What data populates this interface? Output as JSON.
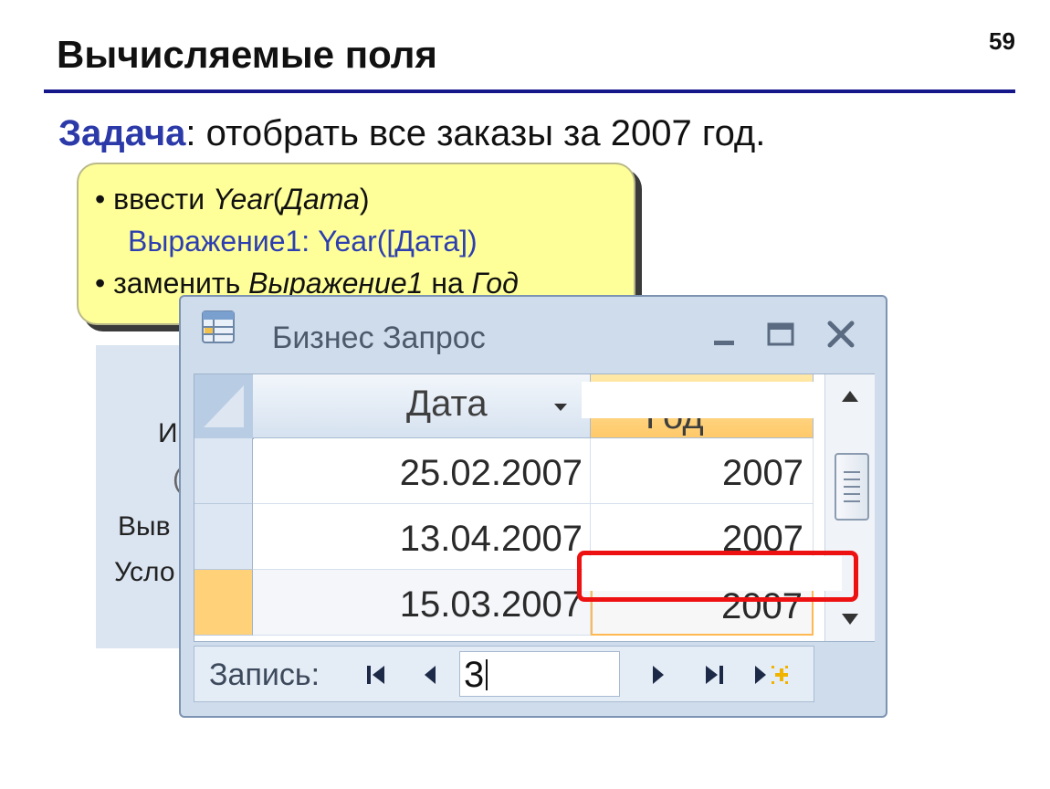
{
  "slide": {
    "title": "Вычисляемые поля",
    "page_number": "59",
    "task_label": "Задача",
    "task_text": ": отобрать все заказы за 2007 год."
  },
  "hint": {
    "line1_prefix": "• ввести ",
    "line1_fn": "Year",
    "line1_open": "(",
    "line1_arg": "Дата",
    "line1_close": ")",
    "line2_expr": "Выражение1: Year([Дата])",
    "line3_prefix": "• заменить ",
    "line3_old": "Выражение1",
    "line3_mid": " на ",
    "line3_new": "Год"
  },
  "design_fragment": {
    "texts": [
      "И",
      "(",
      "Выв",
      "Усло"
    ]
  },
  "window": {
    "title": "Бизнес Запрос",
    "icons": {
      "app": "datasheet-icon",
      "minimize": "minimize-icon",
      "maximize": "maximize-icon",
      "close": "close-icon"
    },
    "columns": [
      "Дата",
      "Год"
    ],
    "rows": [
      {
        "date": "25.02.2007",
        "year": "2007"
      },
      {
        "date": "13.04.2007",
        "year": "2007"
      },
      {
        "date": "15.03.2007",
        "year": "2007"
      }
    ],
    "nav": {
      "label": "Запись:",
      "record": "3"
    }
  },
  "colors": {
    "title_rule": "#14168a",
    "task_label": "#2b3aa8",
    "hint_bg": "#ffff99",
    "expr_text": "#2d3fb0",
    "highlight_frame": "#ee1111",
    "current_row": "#ffd27a"
  }
}
